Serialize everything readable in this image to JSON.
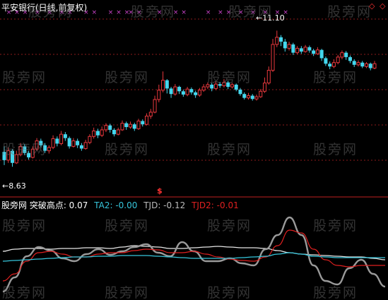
{
  "header": {
    "title": "平安银行(日线,前复权)",
    "diamond": "◇",
    "diamond2": "◇"
  },
  "watermark": {
    "text": "股旁网"
  },
  "colors": {
    "bg": "#000000",
    "up": "#e8383d",
    "down": "#44d7ee",
    "grid": "#8b1a1a",
    "marker": "#cc44cc",
    "white_line": "#e6e6e6",
    "gray_line": "#9a9a9a",
    "red_line": "#e02020",
    "cyan_line": "#36c6dc"
  },
  "annotations": {
    "high_label": "11.10",
    "low_label": "8.63",
    "dollar": "$",
    "arrow": "←"
  },
  "indicator": {
    "name": "股旁网 突破高点: 0.07",
    "ta2": "TA2: -0.00",
    "tjd": "TJD: -0.12",
    "tjd2": "TJD2: -0.01"
  },
  "chart_data": [
    {
      "type": "candlestick",
      "title": "平安银行(日线,前复权)",
      "ylim": [
        8.3,
        11.4
      ],
      "high": 11.1,
      "low": 8.63,
      "candles": [
        [
          8.9,
          8.75,
          9.0,
          8.66
        ],
        [
          8.75,
          8.92,
          8.98,
          8.7
        ],
        [
          8.92,
          8.7,
          8.95,
          8.63
        ],
        [
          8.7,
          8.85,
          8.92,
          8.68
        ],
        [
          8.85,
          9.0,
          9.06,
          8.82
        ],
        [
          9.0,
          8.88,
          9.04,
          8.84
        ],
        [
          8.88,
          8.8,
          8.92,
          8.76
        ],
        [
          8.8,
          8.95,
          9.0,
          8.78
        ],
        [
          8.95,
          9.1,
          9.15,
          8.92
        ],
        [
          9.1,
          9.02,
          9.14,
          8.98
        ],
        [
          9.02,
          8.92,
          9.06,
          8.88
        ],
        [
          8.92,
          8.98,
          9.02,
          8.87
        ],
        [
          8.98,
          9.14,
          9.2,
          8.95
        ],
        [
          9.14,
          9.05,
          9.18,
          9.0
        ],
        [
          9.05,
          9.22,
          9.28,
          9.02
        ],
        [
          9.22,
          9.15,
          9.26,
          9.1
        ],
        [
          9.15,
          9.0,
          9.18,
          8.96
        ],
        [
          9.0,
          9.1,
          9.15,
          8.98
        ],
        [
          9.1,
          9.02,
          9.14,
          8.97
        ],
        [
          9.02,
          8.96,
          9.06,
          8.92
        ],
        [
          8.96,
          9.07,
          9.12,
          8.94
        ],
        [
          9.07,
          9.18,
          9.22,
          9.04
        ],
        [
          9.18,
          9.28,
          9.34,
          9.14
        ],
        [
          9.28,
          9.2,
          9.32,
          9.15
        ],
        [
          9.2,
          9.3,
          9.36,
          9.17
        ],
        [
          9.3,
          9.38,
          9.42,
          9.26
        ],
        [
          9.38,
          9.3,
          9.41,
          9.25
        ],
        [
          9.3,
          9.22,
          9.33,
          9.18
        ],
        [
          9.22,
          9.3,
          9.34,
          9.2
        ],
        [
          9.3,
          9.42,
          9.47,
          9.28
        ],
        [
          9.42,
          9.35,
          9.45,
          9.3
        ],
        [
          9.35,
          9.4,
          9.45,
          9.32
        ],
        [
          9.4,
          9.32,
          9.43,
          9.28
        ],
        [
          9.32,
          9.46,
          9.5,
          9.3
        ],
        [
          9.46,
          9.4,
          9.49,
          9.36
        ],
        [
          9.4,
          9.55,
          9.6,
          9.38
        ],
        [
          9.55,
          9.62,
          9.68,
          9.5
        ],
        [
          9.62,
          9.85,
          9.92,
          9.6
        ],
        [
          9.85,
          10.02,
          10.12,
          9.8
        ],
        [
          10.02,
          10.2,
          10.36,
          9.98
        ],
        [
          10.2,
          10.05,
          10.22,
          9.96
        ],
        [
          10.05,
          9.95,
          10.08,
          9.88
        ],
        [
          9.95,
          10.08,
          10.13,
          9.92
        ],
        [
          10.08,
          10.0,
          10.1,
          9.95
        ],
        [
          10.0,
          9.94,
          10.03,
          9.9
        ],
        [
          9.94,
          10.04,
          10.08,
          9.91
        ],
        [
          10.04,
          9.98,
          10.07,
          9.94
        ],
        [
          9.98,
          9.93,
          10.01,
          9.88
        ],
        [
          9.93,
          10.02,
          10.06,
          9.9
        ],
        [
          10.02,
          10.08,
          10.13,
          9.99
        ],
        [
          10.08,
          10.12,
          10.16,
          10.04
        ],
        [
          10.12,
          10.05,
          10.15,
          10.0
        ],
        [
          10.05,
          10.13,
          10.18,
          10.02
        ],
        [
          10.13,
          10.1,
          10.17,
          10.06
        ],
        [
          10.1,
          10.16,
          10.22,
          10.07
        ],
        [
          10.16,
          10.08,
          10.19,
          10.04
        ],
        [
          10.08,
          10.12,
          10.15,
          10.05
        ],
        [
          10.12,
          10.03,
          10.14,
          10.0
        ],
        [
          10.03,
          9.95,
          10.06,
          9.92
        ],
        [
          9.95,
          9.88,
          9.98,
          9.85
        ],
        [
          9.88,
          9.92,
          9.97,
          9.85
        ],
        [
          9.92,
          9.86,
          9.95,
          9.83
        ],
        [
          9.86,
          9.9,
          9.94,
          9.83
        ],
        [
          9.9,
          10.0,
          10.04,
          9.88
        ],
        [
          10.0,
          10.15,
          10.25,
          9.97
        ],
        [
          10.15,
          10.38,
          10.45,
          10.12
        ],
        [
          10.38,
          10.85,
          10.95,
          10.35
        ],
        [
          10.85,
          10.98,
          11.1,
          10.8
        ],
        [
          10.98,
          10.9,
          11.02,
          10.82
        ],
        [
          10.9,
          10.78,
          10.95,
          10.72
        ],
        [
          10.78,
          10.85,
          10.9,
          10.74
        ],
        [
          10.85,
          10.7,
          10.88,
          10.66
        ],
        [
          10.7,
          10.78,
          10.82,
          10.67
        ],
        [
          10.78,
          10.72,
          10.82,
          10.68
        ],
        [
          10.72,
          10.8,
          10.84,
          10.7
        ],
        [
          10.8,
          10.74,
          10.83,
          10.7
        ],
        [
          10.74,
          10.68,
          10.77,
          10.64
        ],
        [
          10.68,
          10.75,
          10.8,
          10.66
        ],
        [
          10.75,
          10.6,
          10.77,
          10.55
        ],
        [
          10.6,
          10.5,
          10.63,
          10.46
        ],
        [
          10.5,
          10.45,
          10.54,
          10.4
        ],
        [
          10.45,
          10.52,
          10.58,
          10.42
        ],
        [
          10.52,
          10.62,
          10.66,
          10.49
        ],
        [
          10.62,
          10.7,
          10.74,
          10.58
        ],
        [
          10.7,
          10.62,
          10.73,
          10.57
        ],
        [
          10.62,
          10.55,
          10.65,
          10.51
        ],
        [
          10.55,
          10.48,
          10.58,
          10.44
        ],
        [
          10.48,
          10.52,
          10.56,
          10.45
        ],
        [
          10.52,
          10.45,
          10.55,
          10.42
        ],
        [
          10.45,
          10.5,
          10.53,
          10.42
        ],
        [
          10.5,
          10.42,
          10.52,
          10.38
        ],
        [
          10.42,
          10.5,
          10.55,
          10.4
        ]
      ]
    },
    {
      "type": "line",
      "title": "股旁网 突破高点",
      "ylim": [
        -0.6,
        0.6
      ],
      "series": [
        {
          "name": "",
          "color": "white",
          "values": [
            0.02,
            0.05,
            0.06,
            0.06,
            0.05,
            0.06,
            0.06,
            0.07,
            0.07,
            0.06,
            0.08,
            0.1,
            0.09,
            0.08,
            0.06,
            0.06,
            0.07,
            0.08,
            0.09,
            0.08,
            0.07,
            0.07,
            0.06,
            0.03,
            0.0,
            -0.02,
            -0.03,
            -0.04,
            -0.05,
            -0.06,
            -0.06,
            -0.08,
            -0.1
          ]
        },
        {
          "name": "TJD",
          "color": "gray",
          "values": [
            -0.55,
            -0.35,
            -0.05,
            0.08,
            0.03,
            -0.08,
            -0.12,
            -0.02,
            0.05,
            -0.03,
            0.02,
            0.08,
            0.12,
            0.0,
            -0.05,
            0.15,
            0.02,
            -0.12,
            -0.12,
            -0.08,
            -0.15,
            -0.18,
            0.05,
            0.25,
            0.5,
            0.25,
            -0.18,
            -0.4,
            -0.45,
            -0.22,
            -0.1,
            -0.3,
            -0.48
          ]
        },
        {
          "name": "TJD2",
          "color": "red",
          "values": [
            -0.4,
            -0.3,
            -0.12,
            0.0,
            0.02,
            -0.02,
            -0.06,
            -0.06,
            -0.02,
            0.0,
            0.0,
            0.03,
            0.05,
            0.04,
            0.0,
            0.0,
            0.02,
            -0.02,
            -0.06,
            -0.09,
            -0.11,
            -0.12,
            -0.06,
            0.1,
            0.32,
            0.28,
            0.05,
            -0.1,
            -0.18,
            -0.2,
            -0.18,
            -0.18,
            -0.18
          ]
        },
        {
          "name": "TA2",
          "color": "cyan",
          "values": [
            -0.12,
            -0.11,
            -0.1,
            -0.09,
            -0.08,
            -0.07,
            -0.06,
            -0.06,
            -0.05,
            -0.05,
            -0.04,
            -0.04,
            -0.04,
            -0.05,
            -0.06,
            -0.07,
            -0.08,
            -0.08,
            -0.08,
            -0.08,
            -0.07,
            -0.06,
            -0.05,
            -0.02,
            0.0,
            -0.02,
            -0.05,
            -0.06,
            -0.07,
            -0.07,
            -0.07,
            -0.07,
            -0.07
          ]
        }
      ]
    }
  ]
}
